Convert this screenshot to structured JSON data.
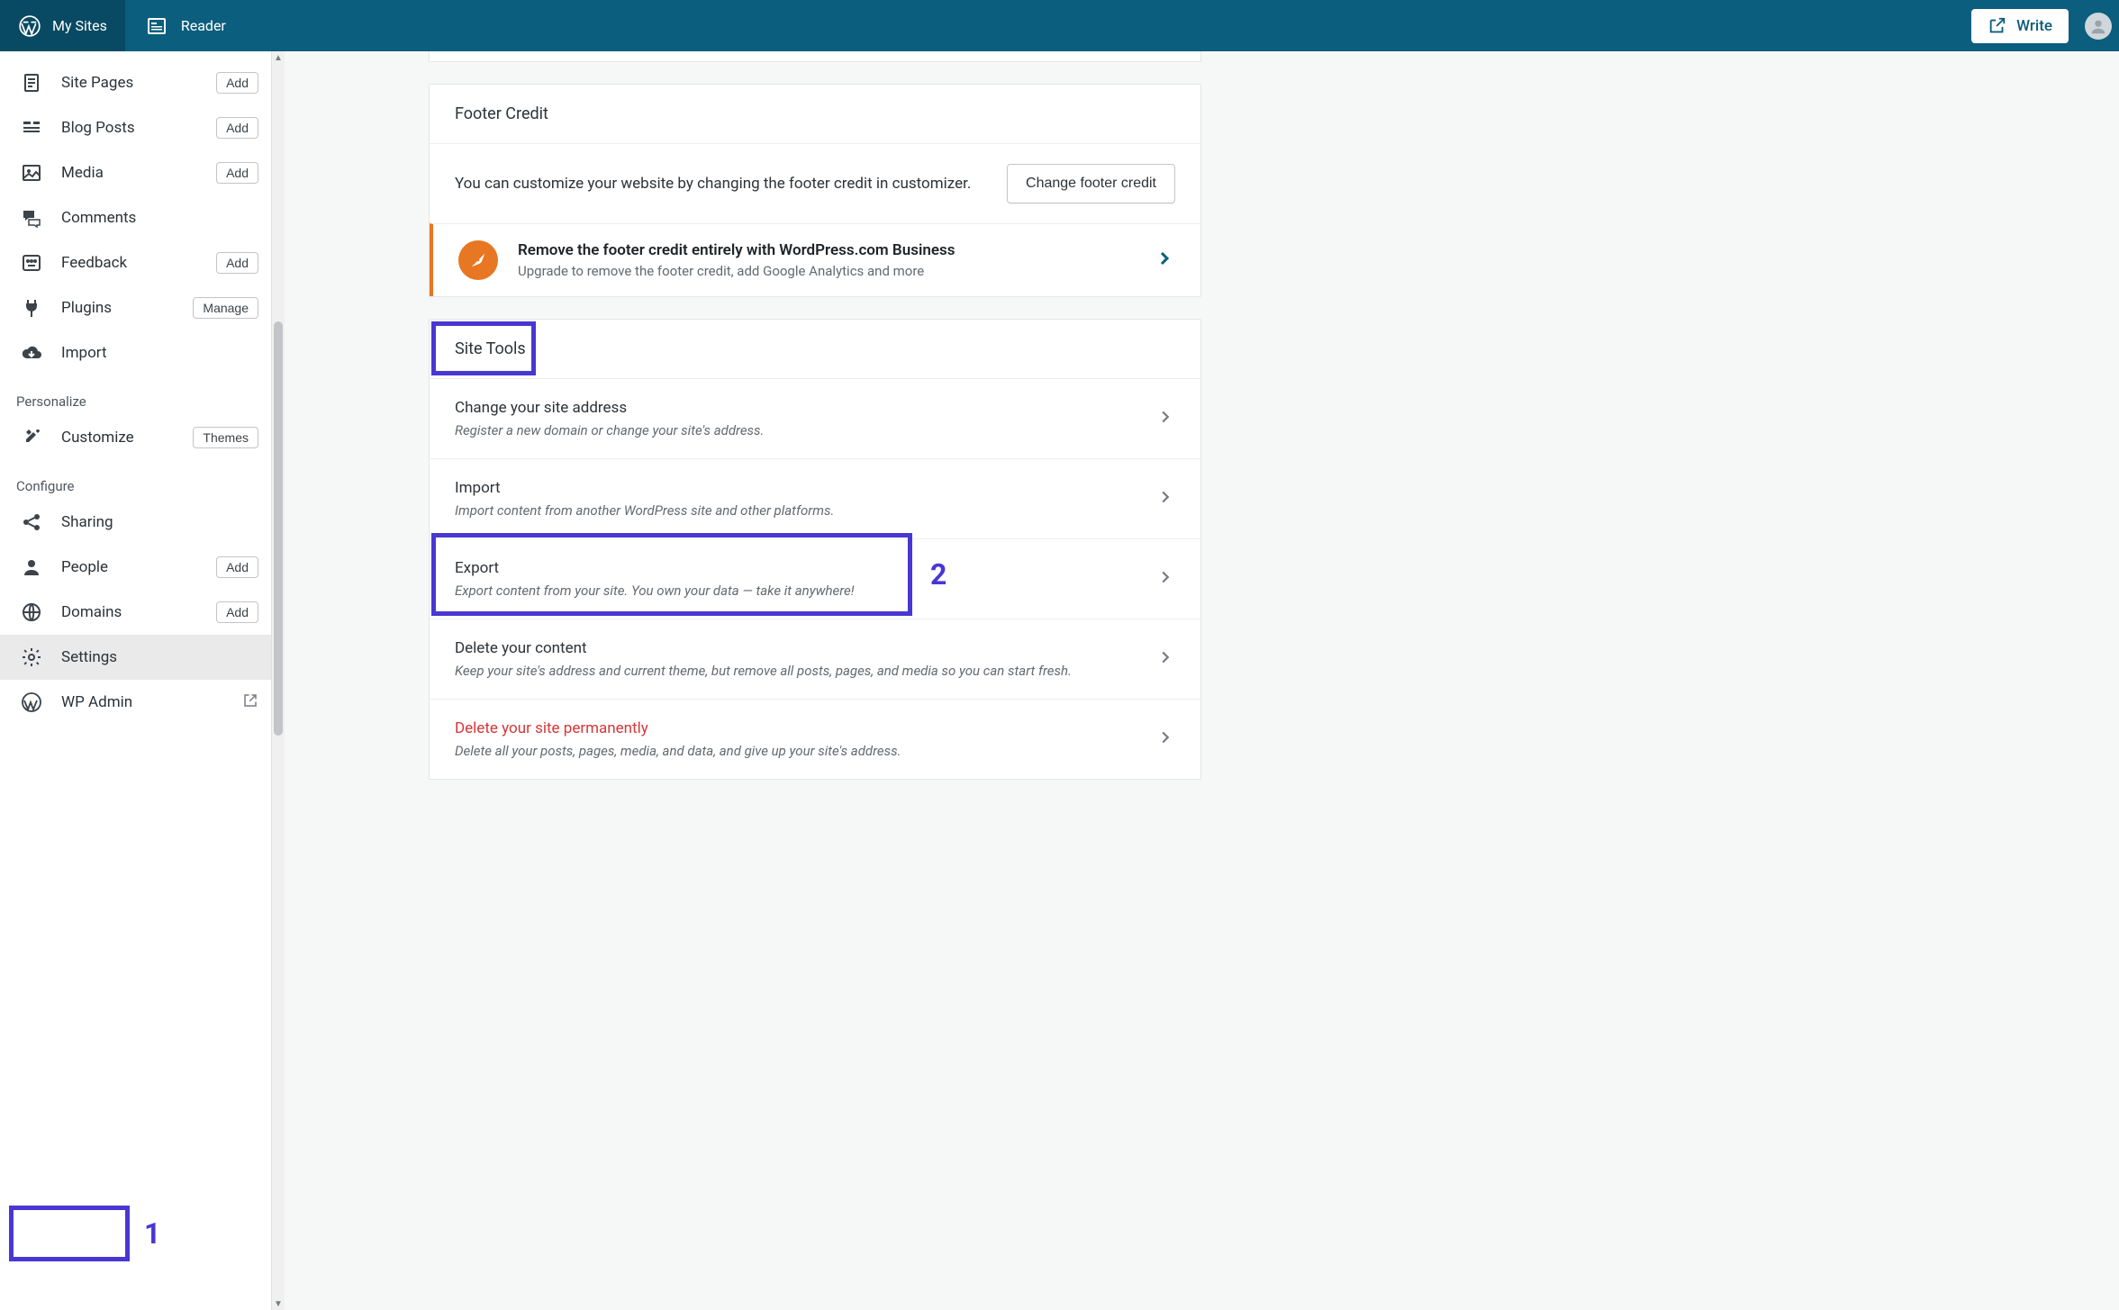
{
  "topbar": {
    "my_sites": "My Sites",
    "reader": "Reader",
    "write": "Write"
  },
  "sidebar": {
    "items": [
      {
        "label": "Site Pages",
        "action": "Add",
        "icon": "page"
      },
      {
        "label": "Blog Posts",
        "action": "Add",
        "icon": "posts"
      },
      {
        "label": "Media",
        "action": "Add",
        "icon": "media"
      },
      {
        "label": "Comments",
        "action": null,
        "icon": "comments"
      },
      {
        "label": "Feedback",
        "action": "Add",
        "icon": "feedback"
      },
      {
        "label": "Plugins",
        "action": "Manage",
        "icon": "plugins"
      },
      {
        "label": "Import",
        "action": null,
        "icon": "import"
      }
    ],
    "heading_personalize": "Personalize",
    "customize": {
      "label": "Customize",
      "action": "Themes"
    },
    "heading_configure": "Configure",
    "configure": [
      {
        "label": "Sharing",
        "action": null,
        "icon": "share"
      },
      {
        "label": "People",
        "action": "Add",
        "icon": "people"
      },
      {
        "label": "Domains",
        "action": "Add",
        "icon": "domains"
      },
      {
        "label": "Settings",
        "action": null,
        "icon": "settings",
        "selected": true
      },
      {
        "label": "WP Admin",
        "action": null,
        "icon": "wp",
        "external": true
      }
    ]
  },
  "footer_credit": {
    "title": "Footer Credit",
    "desc": "You can customize your website by changing the footer credit in customizer.",
    "button": "Change footer credit",
    "upsell_title": "Remove the footer credit entirely with WordPress.com Business",
    "upsell_desc": "Upgrade to remove the footer credit, add Google Analytics and more"
  },
  "site_tools": {
    "title": "Site Tools",
    "rows": [
      {
        "title": "Change your site address",
        "desc": "Register a new domain or change your site's address."
      },
      {
        "title": "Import",
        "desc": "Import content from another WordPress site and other platforms."
      },
      {
        "title": "Export",
        "desc": "Export content from your site. You own your data — take it anywhere!"
      },
      {
        "title": "Delete your content",
        "desc": "Keep your site's address and current theme, but remove all posts, pages, and media so you can start fresh."
      },
      {
        "title": "Delete your site permanently",
        "desc": "Delete all your posts, pages, media, and data, and give up your site's address.",
        "danger": true
      }
    ]
  },
  "annotations": {
    "one": "1",
    "two": "2"
  }
}
